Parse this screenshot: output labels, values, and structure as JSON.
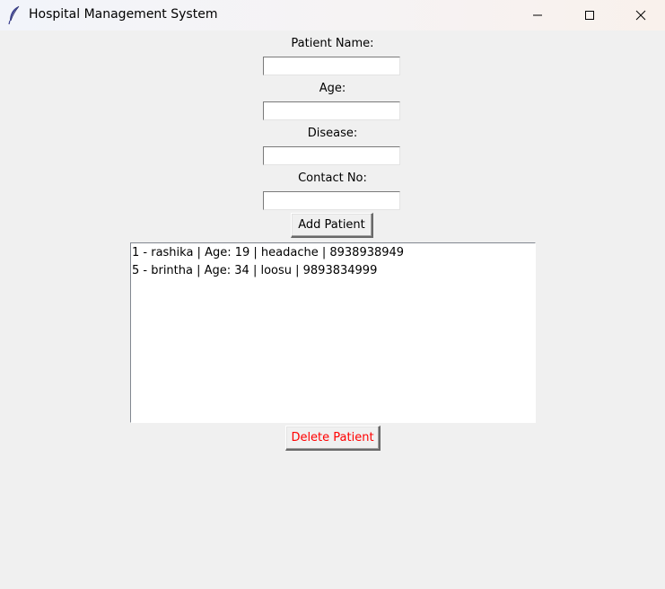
{
  "window": {
    "title": "Hospital Management System",
    "icon": "feather-icon",
    "controls": [
      "minimize-icon",
      "maximize-icon",
      "close-icon"
    ]
  },
  "form": {
    "name_label": "Patient Name:",
    "name_value": "",
    "age_label": "Age:",
    "age_value": "",
    "disease_label": "Disease:",
    "disease_value": "",
    "contact_label": "Contact No:",
    "contact_value": ""
  },
  "buttons": {
    "add_label": "Add Patient",
    "delete_label": "Delete Patient",
    "delete_color": "#ff0000"
  },
  "patients": [
    "1 - rashika | Age: 19 | headache | 8938938949",
    "5 - brintha | Age: 34 | loosu | 9893834999"
  ]
}
